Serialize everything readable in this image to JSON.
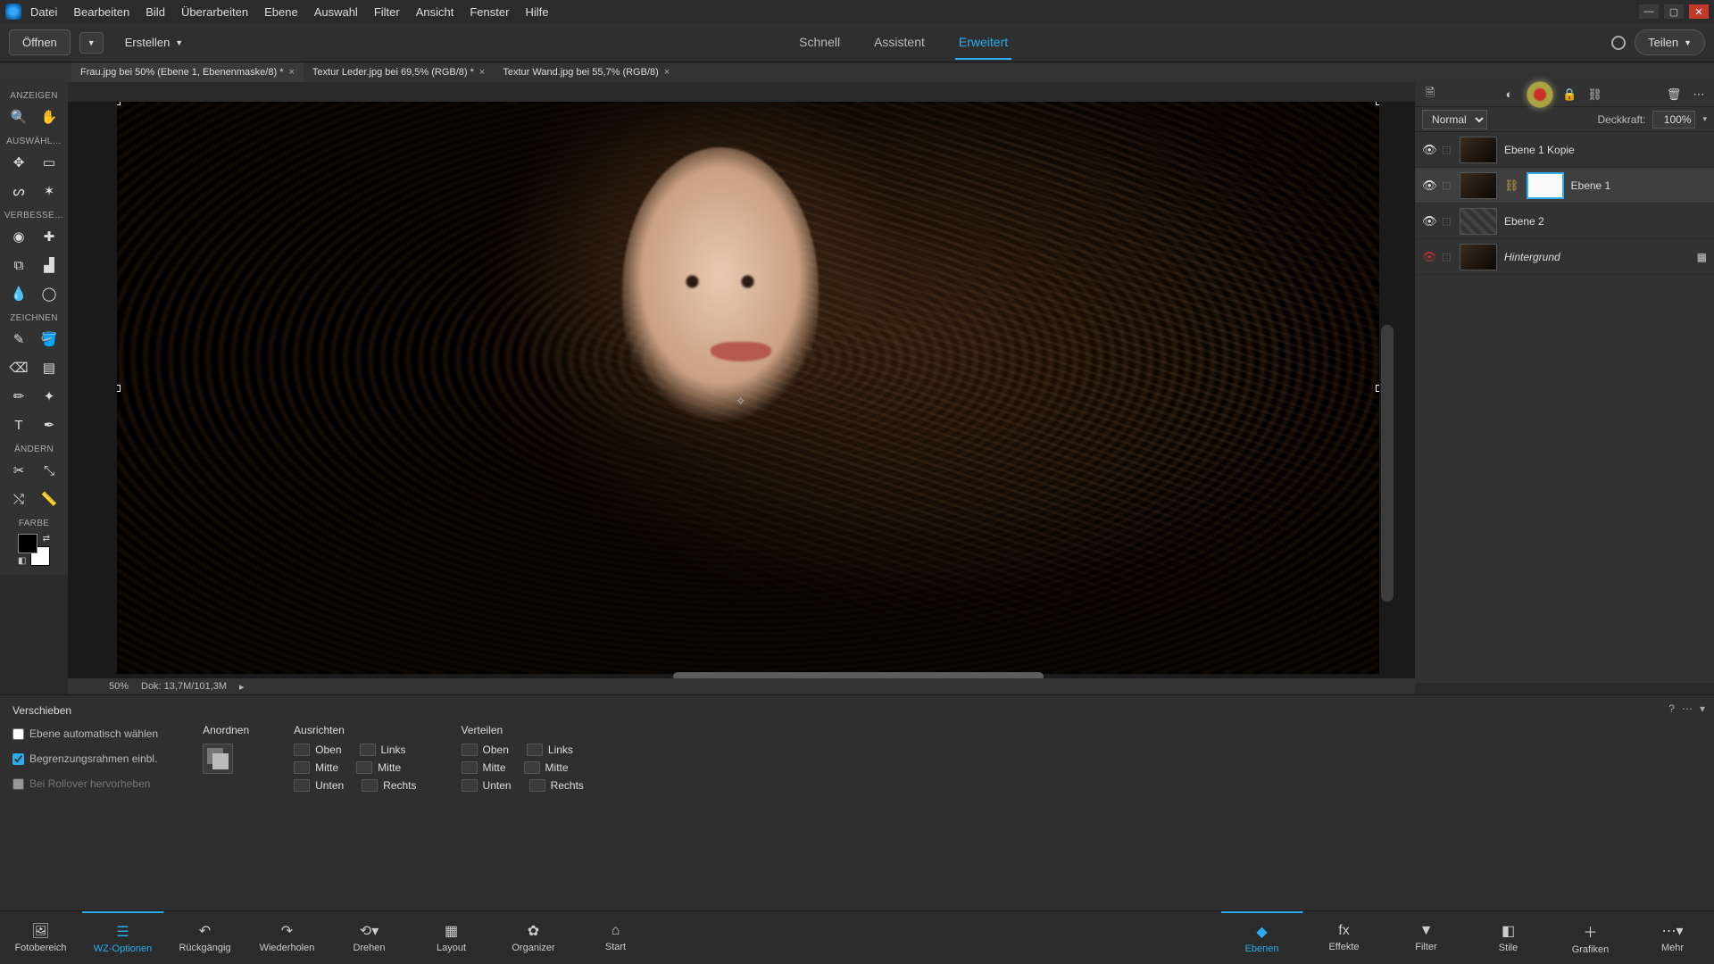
{
  "menu": [
    "Datei",
    "Bearbeiten",
    "Bild",
    "Überarbeiten",
    "Ebene",
    "Auswahl",
    "Filter",
    "Ansicht",
    "Fenster",
    "Hilfe"
  ],
  "optbar": {
    "open": "Öffnen",
    "create": "Erstellen",
    "share": "Teilen"
  },
  "modes": {
    "quick": "Schnell",
    "guided": "Assistent",
    "expert": "Erweitert"
  },
  "tabs": [
    "Frau.jpg bei 50% (Ebene 1, Ebenenmaske/8) *",
    "Textur Leder.jpg bei 69,5% (RGB/8) *",
    "Textur Wand.jpg bei 55,7% (RGB/8)"
  ],
  "left": {
    "groups": {
      "view": "ANZEIGEN",
      "select": "AUSWÄHL…",
      "enhance": "VERBESSE…",
      "draw": "ZEICHNEN",
      "modify": "ÄNDERN",
      "color": "FARBE"
    }
  },
  "status": {
    "zoom": "50%",
    "doc": "Dok: 13,7M/101,3M"
  },
  "toolopts": {
    "title": "Verschieben",
    "chk1": "Ebene automatisch wählen",
    "chk2": "Begrenzungsrahmen einbl.",
    "chk3": "Bei Rollover hervorheben",
    "arrange": "Anordnen",
    "align": "Ausrichten",
    "distribute": "Verteilen",
    "top": "Oben",
    "middle": "Mitte",
    "bottom": "Unten",
    "left": "Links",
    "center": "Mitte",
    "right": "Rechts"
  },
  "bottombar": {
    "left": [
      "Fotobereich",
      "WZ-Optionen",
      "Rückgängig",
      "Wiederholen",
      "Drehen",
      "Layout",
      "Organizer",
      "Start"
    ],
    "right": [
      "Ebenen",
      "Effekte",
      "Filter",
      "Stile",
      "Grafiken",
      "Mehr"
    ]
  },
  "layerspanel": {
    "blend": "Normal",
    "opacityLabel": "Deckkraft:",
    "opacity": "100%",
    "layers": [
      {
        "name": "Ebene 1 Kopie"
      },
      {
        "name": "Ebene 1"
      },
      {
        "name": "Ebene 2"
      },
      {
        "name": "Hintergrund"
      }
    ]
  }
}
